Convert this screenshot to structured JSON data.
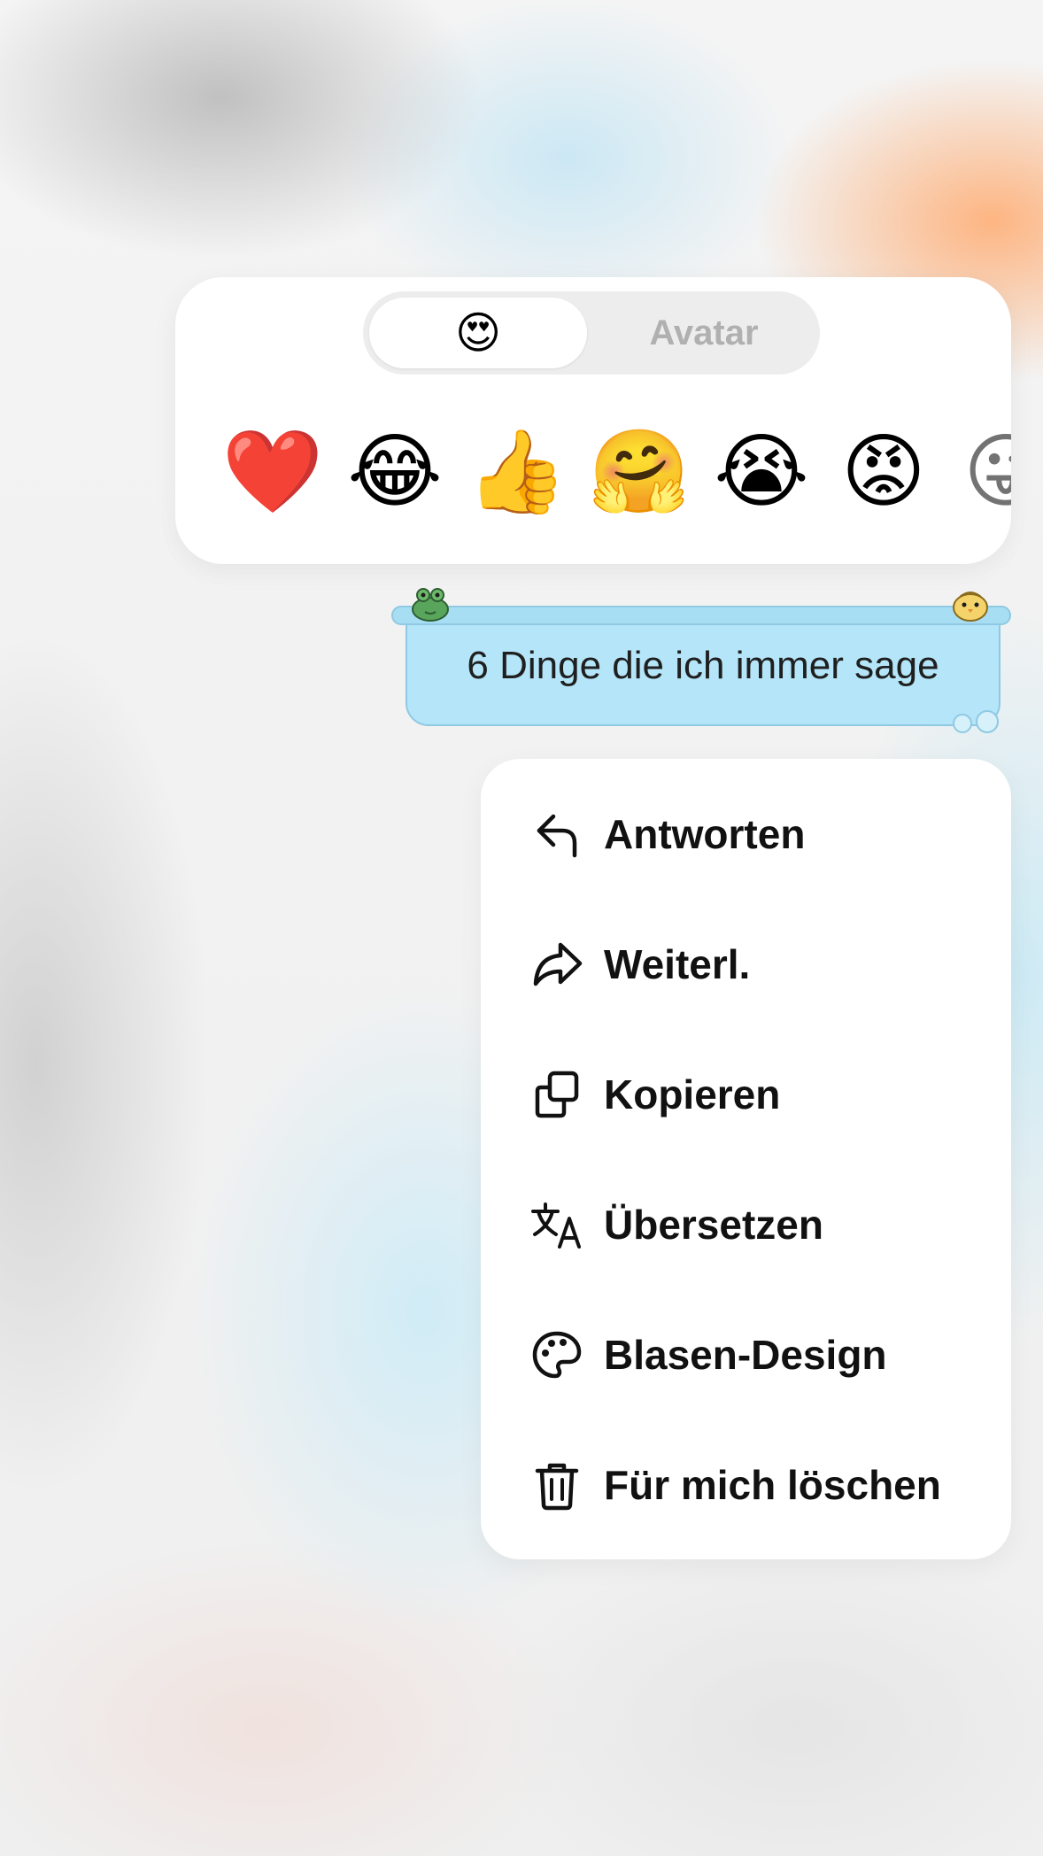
{
  "reaction_panel": {
    "tabs": [
      {
        "label": "😍",
        "selected": true
      },
      {
        "label": "Avatar",
        "selected": false
      }
    ],
    "emojis": [
      "❤️",
      "😂",
      "👍",
      "🤗",
      "😭",
      "😡",
      "😜"
    ]
  },
  "message": {
    "text": "6 Dinge die ich immer sage",
    "bubble_color": "#b4e5f8"
  },
  "context_menu": {
    "items": [
      {
        "label": "Antworten",
        "icon": "reply-icon"
      },
      {
        "label": "Weiterl.",
        "icon": "forward-icon"
      },
      {
        "label": "Kopieren",
        "icon": "copy-icon"
      },
      {
        "label": "Übersetzen",
        "icon": "translate-icon"
      },
      {
        "label": "Blasen-Design",
        "icon": "palette-icon"
      },
      {
        "label": "Für mich löschen",
        "icon": "trash-icon"
      }
    ]
  }
}
